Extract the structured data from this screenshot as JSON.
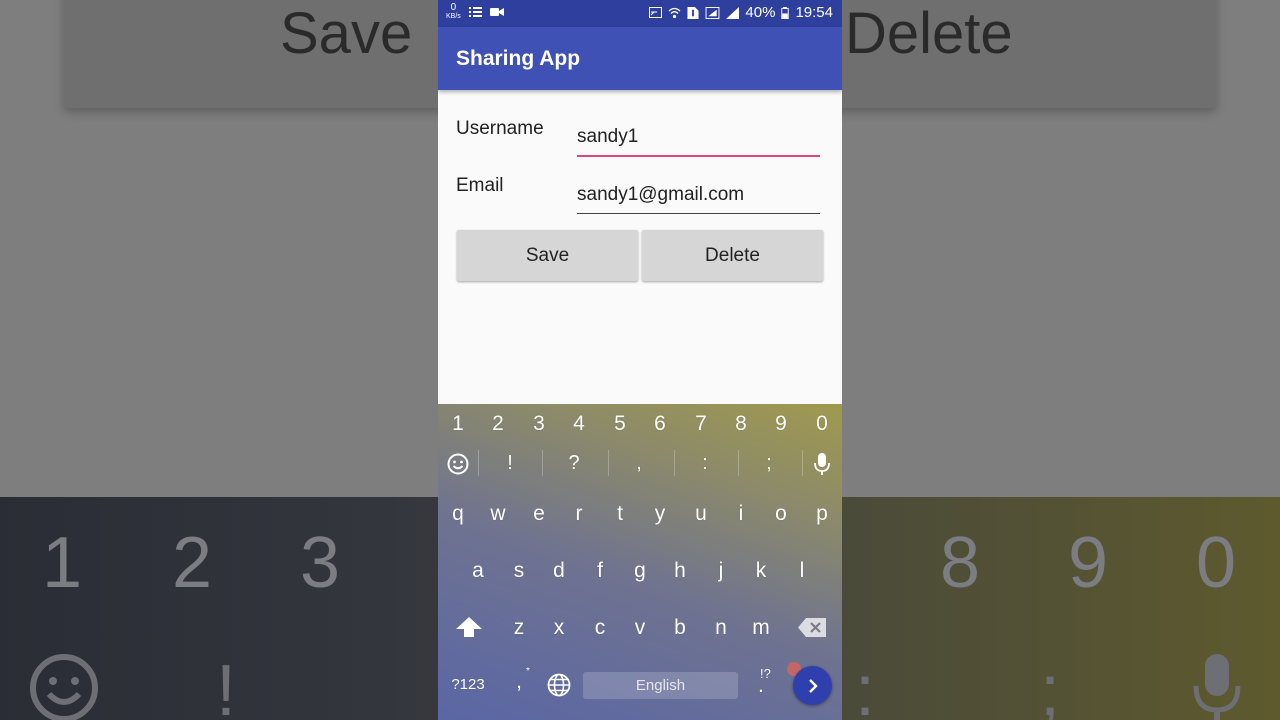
{
  "status_bar": {
    "speed_value": "0",
    "speed_unit": "KB/s",
    "battery_percent": "40%",
    "time": "19:54"
  },
  "app_bar": {
    "title": "Sharing App"
  },
  "form": {
    "username_label": "Username",
    "username_value": "sandy1",
    "email_label": "Email",
    "email_value": "sandy1@gmail.com",
    "save_label": "Save",
    "delete_label": "Delete"
  },
  "keyboard": {
    "number_row": [
      "1",
      "2",
      "3",
      "4",
      "5",
      "6",
      "7",
      "8",
      "9",
      "0"
    ],
    "symbol_row": [
      "!",
      "?",
      ",",
      ":",
      ";"
    ],
    "row1": [
      "q",
      "w",
      "e",
      "r",
      "t",
      "y",
      "u",
      "i",
      "o",
      "p"
    ],
    "row2": [
      "a",
      "s",
      "d",
      "f",
      "g",
      "h",
      "j",
      "k",
      "l"
    ],
    "row3": [
      "z",
      "x",
      "c",
      "v",
      "b",
      "n",
      "m"
    ],
    "mode_key": "?123",
    "comma_key": ",",
    "comma_hint": "*",
    "space_label": "English",
    "period_key": ".",
    "period_hint": "!?"
  },
  "background": {
    "save_text": "Save",
    "delete_text": "Delete",
    "digits": [
      "1",
      "2",
      "3",
      "8",
      "9",
      "0"
    ],
    "symbols": [
      "!",
      ":",
      ";"
    ]
  },
  "colors": {
    "status_bar": "#2f3f9e",
    "app_bar": "#3f51b5",
    "focus_underline": "#e0457b",
    "button": "#d6d6d6",
    "enter_key": "#2f3fae"
  },
  "icons": [
    "video-camera-icon",
    "list-icon",
    "cast-icon",
    "wifi-icon",
    "sim-icon",
    "signal-icon",
    "battery-icon",
    "emoji-icon",
    "mic-icon",
    "shift-icon",
    "backspace-icon",
    "globe-icon",
    "enter-arrow-icon"
  ]
}
